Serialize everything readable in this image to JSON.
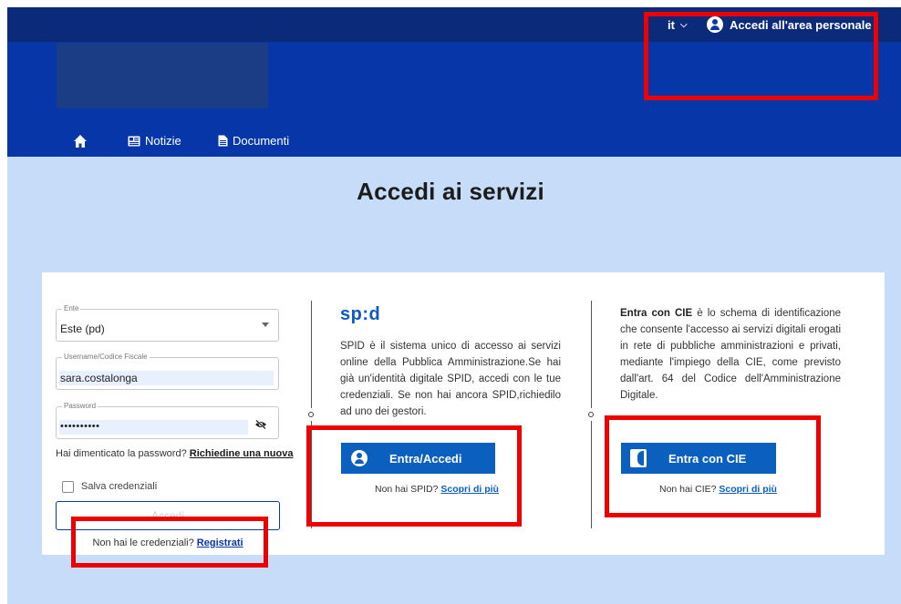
{
  "header": {
    "language": "it",
    "personal_area_link": "Accedi all'area personale"
  },
  "nav": {
    "items": [
      {
        "label": "Notizie"
      },
      {
        "label": "Documenti"
      }
    ]
  },
  "page": {
    "title": "Accedi ai servizi"
  },
  "login_form": {
    "ente_label": "Ente",
    "ente_value": "Este (pd)",
    "username_label": "Username/Codice Fiscale",
    "username_value": "sara.costalonga",
    "password_label": "Password",
    "password_value": "••••••••••",
    "forgot_text": "Hai dimenticato la password?",
    "forgot_link": "Richiedine una nuova",
    "save_credentials_label": "Salva credenziali",
    "save_credentials_checked": false,
    "submit_label": "Accedi",
    "register_text": "Non hai le credenziali?",
    "register_link": "Registrati"
  },
  "spid": {
    "logo_text": "sp:d",
    "description": "SPID è il sistema unico di accesso ai servizi online della Pubblica Amministrazione.Se hai già un'identità digitale SPID, accedi con le tue credenziali. Se non hai ancora SPID,richiedilo ad uno dei gestori.",
    "button_label": "Entra/Accedi",
    "help_text": "Non hai SPID?",
    "help_link": "Scopri di più"
  },
  "cie": {
    "description_bold": "Entra con CIE",
    "description_rest": " è lo schema di identificazione che consente l'accesso ai servizi digitali erogati in rete di pubbliche amministrazioni e privati, mediante l'impiego della CIE, come previsto dall'art. 64 del Codice dell'Amministrazione Digitale.",
    "button_label": "Entra con CIE",
    "help_text": "Non hai CIE?",
    "help_link": "Scopri di più"
  },
  "colors": {
    "topbar": "#0b2a7a",
    "header": "#0736a8",
    "content_bg": "#c6dcf8",
    "primary_button": "#0b5fbf",
    "highlight": "#ee0000"
  }
}
